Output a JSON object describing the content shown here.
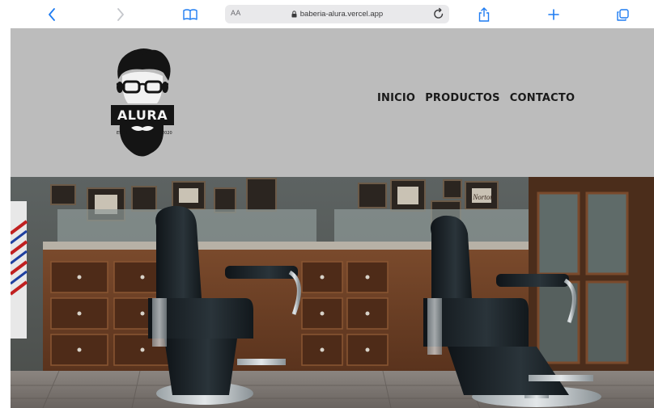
{
  "browser": {
    "text_size_label": "AA",
    "url": "baberia-alura.vercel.app",
    "icons": {
      "back": "chevron-left-icon",
      "forward": "chevron-right-icon",
      "bookmarks": "book-icon",
      "lock": "lock-icon",
      "reload": "reload-icon",
      "share": "share-icon",
      "new_tab": "plus-icon",
      "tabs": "tabs-icon"
    },
    "accent_color": "#1e7cf2"
  },
  "site": {
    "logo": {
      "text": "ALURA",
      "left_caption": "ESTD",
      "right_caption": "2020"
    },
    "nav": [
      "INICIO",
      "PRODUCTOS",
      "CONTACTO"
    ],
    "header_color": "#bcbcbc",
    "hero": {
      "sign_text": "Norton"
    }
  }
}
